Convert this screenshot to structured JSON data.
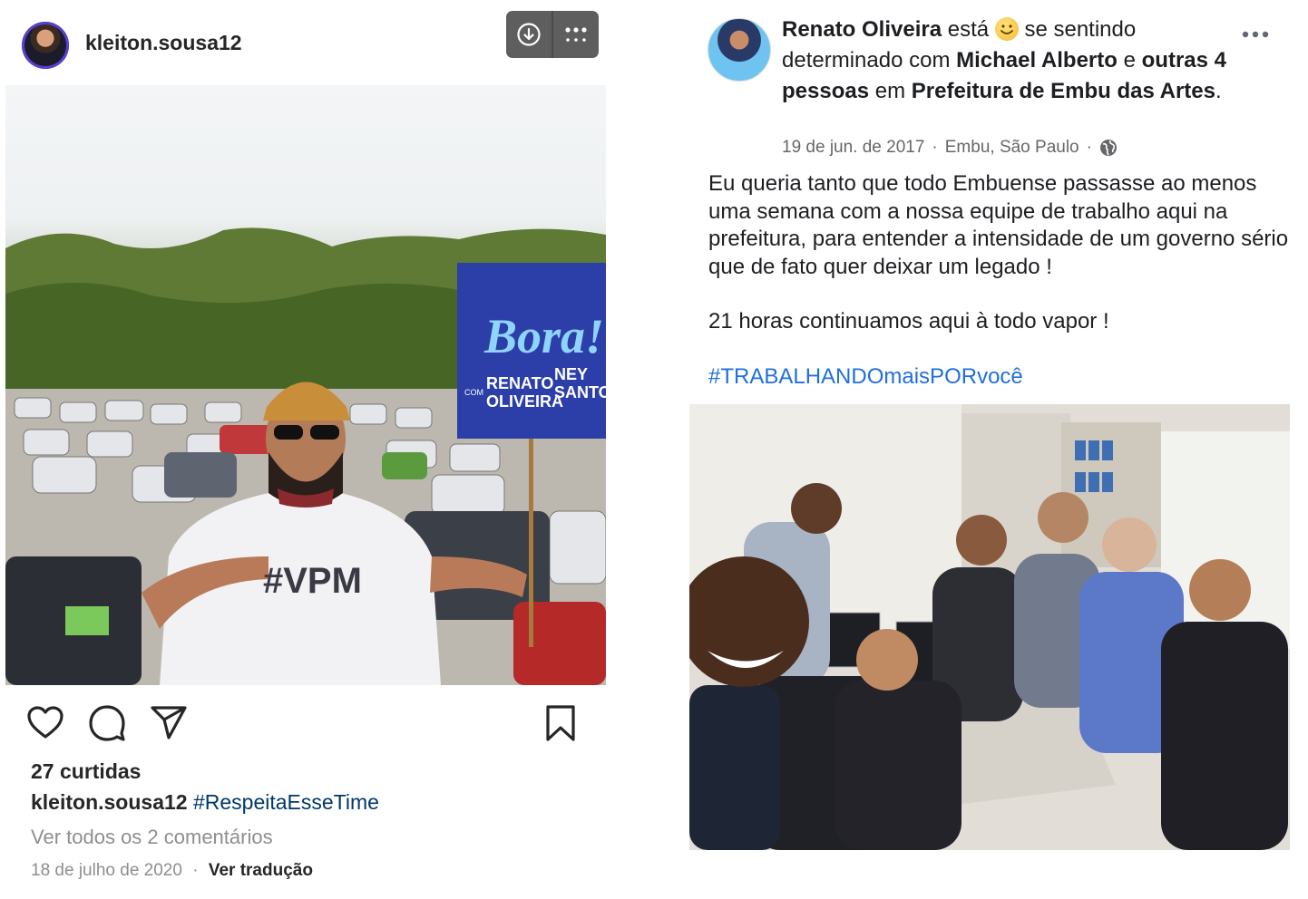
{
  "instagram": {
    "username": "kleiton.sousa12",
    "likes": "27 curtidas",
    "caption_user": "kleiton.sousa12",
    "caption_hashtag": "#RespeitaEsseTime",
    "view_comments": "Ver todos os 2 comentários",
    "date": "18 de julho de 2020",
    "separator": "·",
    "see_translation": "Ver tradução",
    "icons": {
      "download": "download-icon",
      "more": "more-options-icon",
      "like": "heart-icon",
      "comment": "comment-icon",
      "share": "share-icon",
      "save": "bookmark-icon"
    },
    "photo": {
      "sign_bora": "Bora!",
      "sign_name1a": "RENATO",
      "sign_name1b": "OLIVEIRA",
      "sign_name2a": "NEY",
      "sign_name2b": "SANTOS",
      "sign_com": "COM",
      "shirt_text": "#VPM"
    }
  },
  "facebook": {
    "name": "Renato Oliveira",
    "esta": "está",
    "feeling": "se sentindo",
    "feeling_word": "determinado",
    "with_word": "com",
    "tagged": "Michael Alberto",
    "and_word": "e",
    "others": "outras 4 pessoas",
    "in_word": "em",
    "place": "Prefeitura de Embu das Artes",
    "period": ".",
    "date": "19 de jun. de 2017",
    "location": "Embu, São Paulo",
    "dot": "·",
    "privacy_icon": "globe-icon",
    "body_paragraph1": "Eu queria tanto que todo Embuense passasse ao menos uma semana com a nossa equipe de trabalho aqui na prefeitura, para entender a intensidade de um governo sério que de fato quer deixar um legado !",
    "body_paragraph2": "21 horas continuamos aqui à todo vapor !",
    "hashtag": "#TRABALHANDOmaisPORvocê",
    "emoji": "smiling-emoji"
  }
}
